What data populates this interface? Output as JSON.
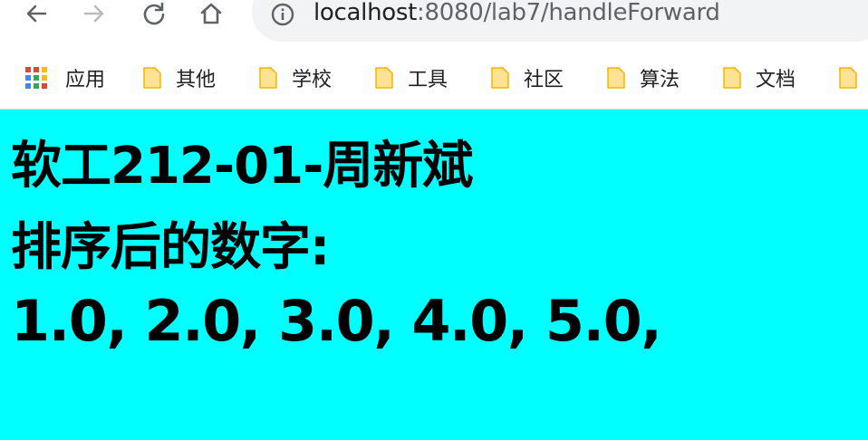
{
  "browser": {
    "url_host": "localhost",
    "url_path": ":8080/lab7/handleForward"
  },
  "bookmarks": [
    {
      "label": "应用",
      "icon": "apps-grid-icon"
    },
    {
      "label": "其他",
      "icon": "folder-icon"
    },
    {
      "label": "学校",
      "icon": "folder-icon"
    },
    {
      "label": "工具",
      "icon": "folder-icon"
    },
    {
      "label": "社区",
      "icon": "folder-icon"
    },
    {
      "label": "算法",
      "icon": "folder-icon"
    },
    {
      "label": "文档",
      "icon": "folder-icon"
    }
  ],
  "page": {
    "background": "#00ffff",
    "heading": "软工212-01-周新斌",
    "subheading": "排序后的数字:",
    "numbers": "1.0, 2.0, 3.0, 4.0, 5.0,"
  }
}
